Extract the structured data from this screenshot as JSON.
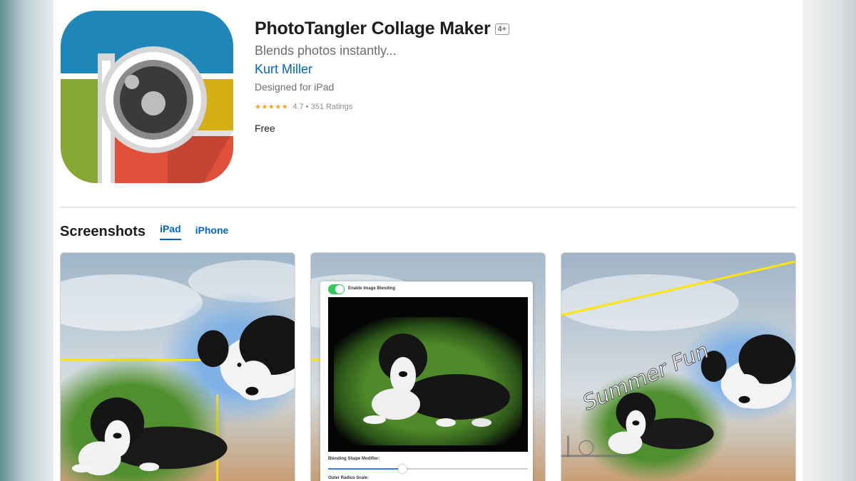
{
  "app": {
    "title": "PhotoTangler Collage Maker",
    "age_rating": "4+",
    "subtitle": "Blends photos instantly...",
    "developer": "Kurt Miller",
    "designed_for": "Designed for iPad",
    "stars_glyph": "★★★★★",
    "rating_text": "4.7 • 351 Ratings",
    "rating_value": 4.7,
    "price": "Free",
    "icon_name": "phototangler-app-icon",
    "icon_colors": [
      "#1e87b8",
      "#86a832",
      "#f2c618",
      "#e0503a",
      "#d7d7d7",
      "#3a3a3a"
    ]
  },
  "screenshots": {
    "title": "Screenshots",
    "tabs": [
      {
        "label": "iPad",
        "active": true
      },
      {
        "label": "iPhone",
        "active": false
      }
    ],
    "items": [
      {
        "name": "screenshot-1"
      },
      {
        "name": "screenshot-2",
        "enable_label": "Enable Image Blending",
        "enabled": true,
        "shape_label": "Blending Shape Modifier:",
        "shape_value": 0.37,
        "radius_label": "Outer Radius Scale:"
      },
      {
        "name": "screenshot-3",
        "overlay_text": "Summer Fun"
      }
    ]
  },
  "colors": {
    "link": "#0066cc",
    "star": "#f0a520",
    "toggle_on": "#34c759"
  }
}
